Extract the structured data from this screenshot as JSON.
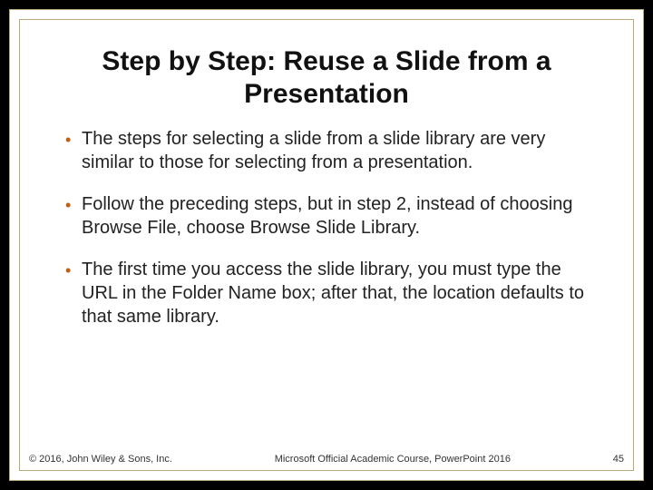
{
  "title": "Step by Step: Reuse a Slide from a Presentation",
  "bullets": [
    "The steps for selecting a slide from a slide library are very similar to those for selecting from a presentation.",
    "Follow the preceding steps, but in step 2, instead of choosing Browse File, choose Browse Slide Library.",
    "The first time you access the slide library, you must type the URL in the Folder Name box; after that, the location defaults to that same library."
  ],
  "footer": {
    "left": "© 2016, John Wiley & Sons, Inc.",
    "center": "Microsoft Official Academic Course, PowerPoint 2016",
    "right": "45"
  }
}
